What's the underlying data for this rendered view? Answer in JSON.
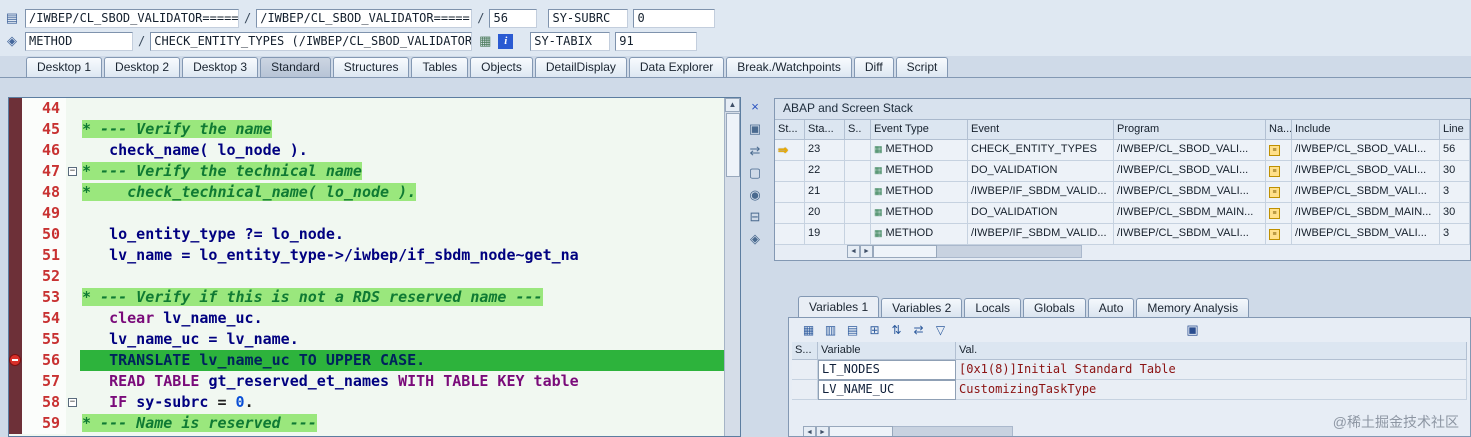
{
  "top": {
    "row1": {
      "class_field": "/IWBEP/CL_SBOD_VALIDATOR=====",
      "class_field2": "/IWBEP/CL_SBOD_VALIDATOR=====",
      "slash": "/",
      "line_field": "56",
      "sy_subrc_label": "SY-SUBRC",
      "sy_subrc_value": "0"
    },
    "row2": {
      "event_type_field": "METHOD",
      "slash": "/",
      "event_field": "CHECK_ENTITY_TYPES (/IWBEP/CL_SBOD_VALIDATOR)",
      "sy_tabix_label": "SY-TABIX",
      "sy_tabix_value": "91"
    }
  },
  "tabs": [
    {
      "label": "Desktop 1",
      "active": false
    },
    {
      "label": "Desktop 2",
      "active": false
    },
    {
      "label": "Desktop 3",
      "active": false
    },
    {
      "label": "Standard",
      "active": true
    },
    {
      "label": "Structures",
      "active": false
    },
    {
      "label": "Tables",
      "active": false
    },
    {
      "label": "Objects",
      "active": false
    },
    {
      "label": "DetailDisplay",
      "active": false
    },
    {
      "label": "Data Explorer",
      "active": false
    },
    {
      "label": "Break./Watchpoints",
      "active": false
    },
    {
      "label": "Diff",
      "active": false
    },
    {
      "label": "Script",
      "active": false
    }
  ],
  "editor": {
    "lines": [
      {
        "num": "44",
        "segs": []
      },
      {
        "num": "45",
        "segs": [
          {
            "t": "* --- Verify the name",
            "c": "cm"
          }
        ]
      },
      {
        "num": "46",
        "segs": [
          {
            "t": "   ",
            "c": "pl"
          },
          {
            "t": "check_name( lo_node ).",
            "c": "id"
          }
        ]
      },
      {
        "num": "47",
        "fold": true,
        "segs": [
          {
            "t": "* --- Verify the technical name",
            "c": "cm"
          }
        ]
      },
      {
        "num": "48",
        "segs": [
          {
            "t": "*    check_technical_name( lo_node ).",
            "c": "cm"
          }
        ]
      },
      {
        "num": "49",
        "segs": []
      },
      {
        "num": "50",
        "segs": [
          {
            "t": "   ",
            "c": "pl"
          },
          {
            "t": "lo_entity_type ?= lo_node.",
            "c": "id"
          }
        ]
      },
      {
        "num": "51",
        "segs": [
          {
            "t": "   ",
            "c": "pl"
          },
          {
            "t": "lv_name = lo_entity_type->/iwbep/if_sbdm_node~get_na",
            "c": "id"
          }
        ]
      },
      {
        "num": "52",
        "segs": []
      },
      {
        "num": "53",
        "segs": [
          {
            "t": "* --- Verify if this is not a RDS reserved name ---",
            "c": "cm"
          }
        ]
      },
      {
        "num": "54",
        "segs": [
          {
            "t": "   ",
            "c": "pl"
          },
          {
            "t": "clear",
            "c": "kw"
          },
          {
            "t": " ",
            "c": "pl"
          },
          {
            "t": "lv_name_uc.",
            "c": "id"
          }
        ]
      },
      {
        "num": "55",
        "segs": [
          {
            "t": "   ",
            "c": "pl"
          },
          {
            "t": "lv_name_uc = lv_name.",
            "c": "id"
          }
        ]
      },
      {
        "num": "56",
        "current": true,
        "breakpoint": true,
        "segs": [
          {
            "t": "   TRANSLATE lv_name_uc TO UPPER CASE.",
            "c": "cur"
          }
        ]
      },
      {
        "num": "57",
        "segs": [
          {
            "t": "   ",
            "c": "pl"
          },
          {
            "t": "READ TABLE",
            "c": "kw"
          },
          {
            "t": " ",
            "c": "pl"
          },
          {
            "t": "gt_reserved_et_names",
            "c": "id"
          },
          {
            "t": " ",
            "c": "pl"
          },
          {
            "t": "WITH TABLE KEY",
            "c": "kw"
          },
          {
            "t": " table",
            "c": "kw"
          }
        ]
      },
      {
        "num": "58",
        "fold": true,
        "segs": [
          {
            "t": "   ",
            "c": "pl"
          },
          {
            "t": "IF",
            "c": "kw"
          },
          {
            "t": " ",
            "c": "pl"
          },
          {
            "t": "sy-subrc",
            "c": "id"
          },
          {
            "t": " = ",
            "c": "pl"
          },
          {
            "t": "0",
            "c": "lit"
          },
          {
            "t": ".",
            "c": "pl"
          }
        ]
      },
      {
        "num": "59",
        "segs": [
          {
            "t": "* --- Name is reserved ---",
            "c": "cm"
          }
        ]
      }
    ]
  },
  "tool_strip": [
    {
      "name": "close-tool-icon",
      "glyph": "×",
      "color": "#2a52c0"
    },
    {
      "name": "new-tool-icon",
      "glyph": "▣",
      "color": "#4a6a8f"
    },
    {
      "name": "swap-tool-icon",
      "glyph": "⇄",
      "color": "#4a6a8f"
    },
    {
      "name": "maximize-tool-icon",
      "glyph": "▢",
      "color": "#4a6a8f"
    },
    {
      "name": "tool-services-icon",
      "glyph": "◉",
      "color": "#4a6a8f"
    },
    {
      "name": "lock-icon",
      "glyph": "⊟",
      "color": "#4a6a8f"
    },
    {
      "name": "link-tool-icon",
      "glyph": "◈",
      "color": "#4a6a8f"
    }
  ],
  "stack": {
    "title": "ABAP and Screen Stack",
    "columns": [
      "St...",
      "Sta...",
      "S..",
      "Event Type",
      "Event",
      "Program",
      "Na...",
      "Include",
      "Line"
    ],
    "rows": [
      {
        "current": true,
        "step": "23",
        "event_type": "METHOD",
        "event": "CHECK_ENTITY_TYPES",
        "program": "/IWBEP/CL_SBOD_VALI...",
        "include": "/IWBEP/CL_SBOD_VALI...",
        "line": "56"
      },
      {
        "current": false,
        "step": "22",
        "event_type": "METHOD",
        "event": "DO_VALIDATION",
        "program": "/IWBEP/CL_SBOD_VALI...",
        "include": "/IWBEP/CL_SBOD_VALI...",
        "line": "30"
      },
      {
        "current": false,
        "step": "21",
        "event_type": "METHOD",
        "event": "/IWBEP/IF_SBDM_VALID...",
        "program": "/IWBEP/CL_SBDM_VALI...",
        "include": "/IWBEP/CL_SBDM_VALI...",
        "line": "3"
      },
      {
        "current": false,
        "step": "20",
        "event_type": "METHOD",
        "event": "DO_VALIDATION",
        "program": "/IWBEP/CL_SBDM_MAIN...",
        "include": "/IWBEP/CL_SBDM_MAIN...",
        "line": "30"
      },
      {
        "current": false,
        "step": "19",
        "event_type": "METHOD",
        "event": "/IWBEP/IF_SBDM_VALID...",
        "program": "/IWBEP/CL_SBDM_VALI...",
        "include": "/IWBEP/CL_SBDM_VALI...",
        "line": "3"
      }
    ]
  },
  "variables": {
    "tabs": [
      {
        "label": "Variables 1",
        "active": true
      },
      {
        "label": "Variables 2",
        "active": false
      },
      {
        "label": "Locals",
        "active": false
      },
      {
        "label": "Globals",
        "active": false
      },
      {
        "label": "Auto",
        "active": false
      },
      {
        "label": "Memory Analysis",
        "active": false
      }
    ],
    "toolbar": [
      {
        "name": "delete-variables-icon",
        "glyph": "▦"
      },
      {
        "name": "change-variable-icon",
        "glyph": "▥"
      },
      {
        "name": "table-display-icon",
        "glyph": "▤"
      },
      {
        "name": "column-config-icon",
        "glyph": "⊞"
      },
      {
        "name": "sort-icon",
        "glyph": "⇅"
      },
      {
        "name": "transfer-icon",
        "glyph": "⇄"
      },
      {
        "name": "filter-icon",
        "glyph": "▽"
      }
    ],
    "columns": [
      "S...",
      "Variable",
      "Val."
    ],
    "rows": [
      {
        "variable": "LT_NODES",
        "value": "[0x1(8)]Initial Standard Table"
      },
      {
        "variable": "LV_NAME_UC",
        "value": "CustomizingTaskType"
      }
    ]
  },
  "icons": {
    "session": "▤",
    "debugger": "◈",
    "change_display": "▦",
    "info": "i",
    "current_arrow": "⇒",
    "method": "▦",
    "nav": "≡",
    "fold": "−",
    "scroll_up": "▲",
    "scroll_left": "◄",
    "scroll_right": "►",
    "save": "▣"
  },
  "watermark": "@稀土掘金技术社区"
}
